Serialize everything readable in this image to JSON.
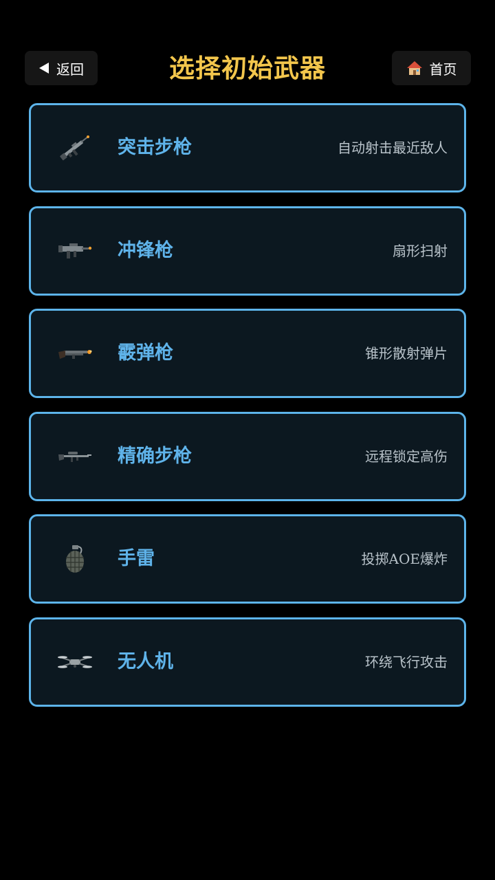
{
  "header": {
    "back_label": "返回",
    "title": "选择初始武器",
    "home_label": "首页"
  },
  "weapons": [
    {
      "name": "突击步枪",
      "desc": "自动射击最近敌人",
      "icon": "assault-rifle-icon"
    },
    {
      "name": "冲锋枪",
      "desc": "扇形扫射",
      "icon": "smg-icon"
    },
    {
      "name": "霰弹枪",
      "desc": "锥形散射弹片",
      "icon": "shotgun-icon"
    },
    {
      "name": "精确步枪",
      "desc": "远程锁定高伤",
      "icon": "sniper-rifle-icon"
    },
    {
      "name": "手雷",
      "desc": "投掷AOE爆炸",
      "icon": "grenade-icon"
    },
    {
      "name": "无人机",
      "desc": "环绕飞行攻击",
      "icon": "drone-icon"
    }
  ],
  "colors": {
    "background": "#000000",
    "title": "#f3c64c",
    "card_border": "#5db4ea",
    "card_bg": "#0c1820",
    "weapon_name": "#5fb3ea",
    "weapon_desc": "#b9c3ca"
  }
}
